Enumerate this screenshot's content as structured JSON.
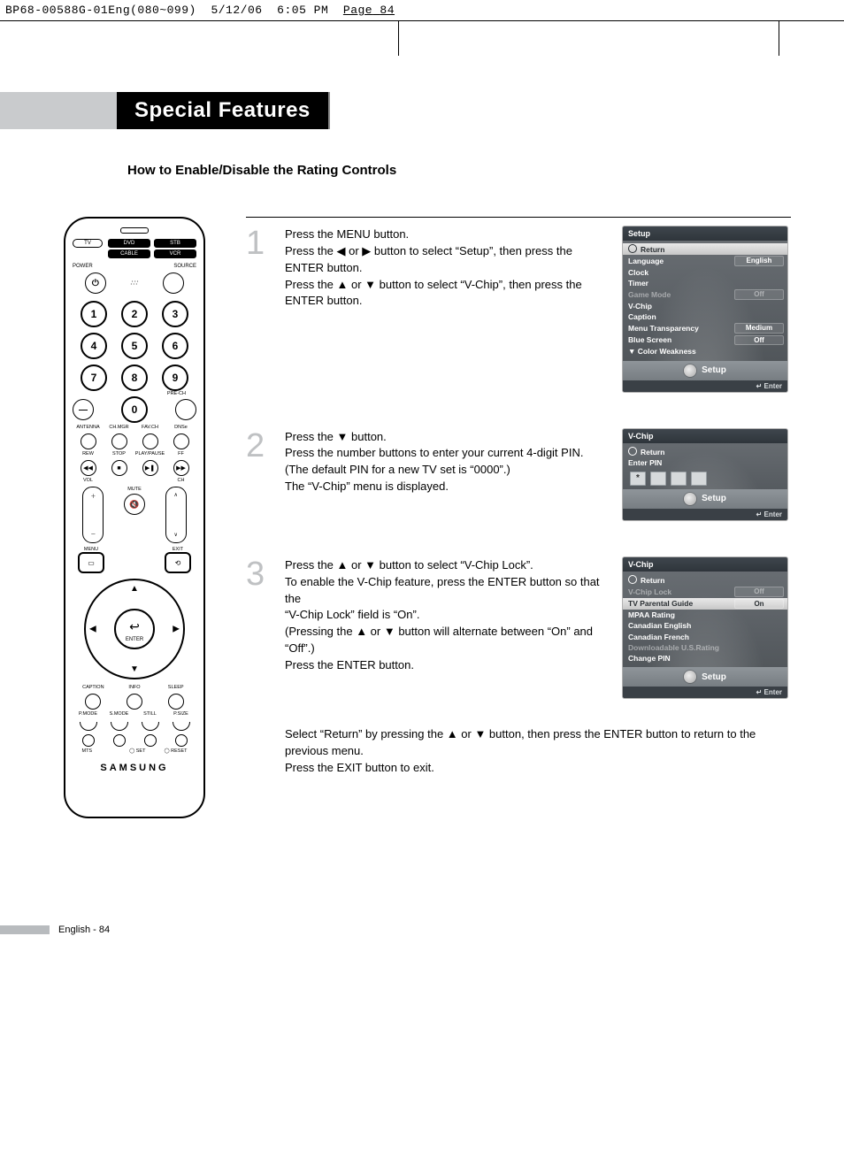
{
  "slug": {
    "jobid": "BP68-00588G-01Eng(080~099)",
    "date": "5/12/06",
    "time": "6:05 PM",
    "page_label": "Page",
    "page_num": "84"
  },
  "heading": "Special Features",
  "subheading": "How to Enable/Disable the Rating Controls",
  "remote": {
    "modes": [
      "TV",
      "DVD",
      "STB",
      "CABLE",
      "VCR"
    ],
    "labels": {
      "power": "POWER",
      "source": "SOURCE",
      "antenna": "ANTENNA",
      "chmgr": "CH.MGR",
      "favch": "FAV.CH",
      "dnse": "DNSe",
      "rew": "REW",
      "stop": "STOP",
      "playpause": "PLAY/PAUSE",
      "ff": "FF",
      "vol": "VOL",
      "ch": "CH",
      "mute": "MUTE",
      "menu": "MENU",
      "exit": "EXIT",
      "enter": "ENTER",
      "prech": "PRE-CH",
      "caption": "CAPTION",
      "info": "INFO",
      "sleep": "SLEEP",
      "pmode": "P.MODE",
      "smode": "S.MODE",
      "still": "STILL",
      "psize": "P.SIZE",
      "mts": "MTS",
      "set": "SET",
      "reset": "RESET",
      "dash": "—"
    },
    "numbers": [
      "1",
      "2",
      "3",
      "4",
      "5",
      "6",
      "7",
      "8",
      "9",
      "0"
    ],
    "brand": "SAMSUNG"
  },
  "steps": [
    {
      "n": "1",
      "text": "Press the MENU button.\nPress the ◀ or ▶ button to select “Setup”, then press  the ENTER button.\nPress the ▲ or ▼ button to select “V-Chip”, then press the ENTER button.",
      "osd": {
        "title": "Setup",
        "lines": [
          {
            "label": "Return",
            "sel": true,
            "icon": true
          },
          {
            "label": "Language",
            "val": "English"
          },
          {
            "label": "Clock"
          },
          {
            "label": "Timer"
          },
          {
            "label": "Game Mode",
            "val": "Off",
            "dim": true
          },
          {
            "label": "V-Chip"
          },
          {
            "label": "Caption"
          },
          {
            "label": "Menu Transparency",
            "val": "Medium"
          },
          {
            "label": "Blue Screen",
            "val": "Off"
          },
          {
            "label": "▼ Color Weakness"
          }
        ],
        "tray": "Setup",
        "enter": "Enter"
      }
    },
    {
      "n": "2",
      "text": "Press the ▼ button.\nPress the number buttons to enter your current 4-digit PIN.\n(The default PIN for a new TV set is “0000”.)\nThe “V-Chip” menu is displayed.",
      "osd": {
        "title": "V-Chip",
        "lines": [
          {
            "label": "Return",
            "icon": true
          },
          {
            "label": "Enter PIN",
            "pin": true
          }
        ],
        "tray": "Setup",
        "enter": "Enter"
      }
    },
    {
      "n": "3",
      "text": "Press the ▲ or ▼ button to select “V-Chip Lock”.\nTo enable the V-Chip feature, press the ENTER button so that the \n“V-Chip Lock” field is “On”.\n(Pressing the ▲ or ▼ button will alternate between “On” and “Off”.)\nPress the ENTER button.",
      "osd": {
        "title": "V-Chip",
        "lines": [
          {
            "label": "Return",
            "icon": true
          },
          {
            "label": "V-Chip Lock",
            "val": "Off",
            "dim": true
          },
          {
            "label": "TV Parental Guidelines",
            "val": "On",
            "sel": true,
            "truncate": true
          },
          {
            "label": "MPAA Rating"
          },
          {
            "label": "Canadian English"
          },
          {
            "label": "Canadian French"
          },
          {
            "label": "Downloadable U.S.Rating",
            "dim": true
          },
          {
            "label": "Change PIN"
          }
        ],
        "tray": "Setup",
        "enter": "Enter"
      }
    }
  ],
  "closing": "Select “Return” by pressing the ▲ or ▼ button, then press the ENTER button to return to the previous menu.\nPress the EXIT button to exit.",
  "footer": "English - 84",
  "starpin": "*"
}
